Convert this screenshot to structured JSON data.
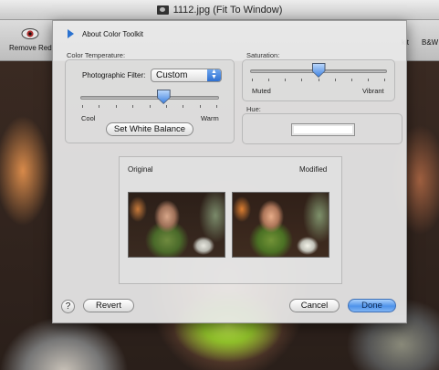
{
  "window": {
    "title": "1112.jpg (Fit To Window)",
    "toolbar": {
      "left_item_label": "Remove Red",
      "right_item_1_label": "kit",
      "right_item_2_label": "B&W"
    }
  },
  "sheet": {
    "header_label": "About Color Toolkit",
    "color_temperature": {
      "label": "Color Temperature:",
      "filter_label": "Photographic Filter:",
      "filter_value": "Custom",
      "slider_value": 0.6,
      "min_label": "Cool",
      "max_label": "Warm",
      "white_balance_button": "Set White Balance"
    },
    "saturation": {
      "label": "Saturation:",
      "slider_value": 0.5,
      "min_label": "Muted",
      "max_label": "Vibrant"
    },
    "hue": {
      "label": "Hue:",
      "swatch_color": "#ffffff"
    },
    "preview": {
      "original_label": "Original",
      "modified_label": "Modified"
    },
    "buttons": {
      "help": "?",
      "revert": "Revert",
      "cancel": "Cancel",
      "done": "Done"
    }
  },
  "colors": {
    "accent": "#4f93ea",
    "disclosure": "#2a72d0"
  }
}
